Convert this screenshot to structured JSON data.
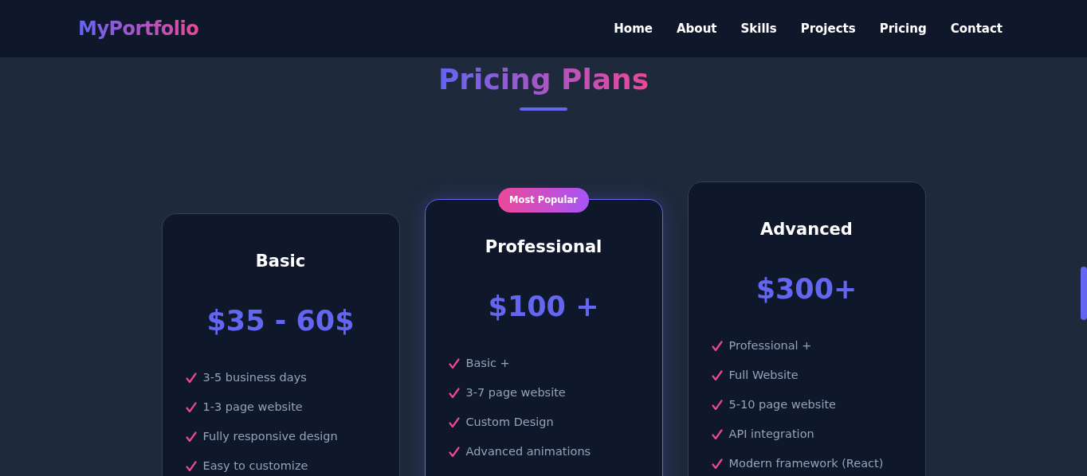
{
  "navbar": {
    "brand": "MyPortfolio",
    "links": [
      {
        "label": "Home",
        "selected": false
      },
      {
        "label": "About",
        "selected": false
      },
      {
        "label": "Skills",
        "selected": false
      },
      {
        "label": "Projects",
        "selected": false
      },
      {
        "label": "Pricing",
        "selected": false
      },
      {
        "label": "Contact",
        "selected": false
      }
    ]
  },
  "section": {
    "title": "Pricing Plans"
  },
  "plans": [
    {
      "name": "Basic",
      "price": "$35 - 60$",
      "featured": false,
      "features": [
        "3-5 business days",
        "1-3 page website",
        "Fully responsive design",
        "Easy to customize"
      ]
    },
    {
      "name": "Professional",
      "price": "$100 +",
      "featured": true,
      "badge": "Most Popular",
      "features": [
        "Basic +",
        "3-7 page website",
        "Custom Design",
        "Advanced animations"
      ]
    },
    {
      "name": "Advanced",
      "price": "$300+",
      "featured": false,
      "features": [
        "Professional +",
        "Full Website",
        "5-10 page website",
        "API integration",
        "Modern framework (React)"
      ]
    }
  ]
}
